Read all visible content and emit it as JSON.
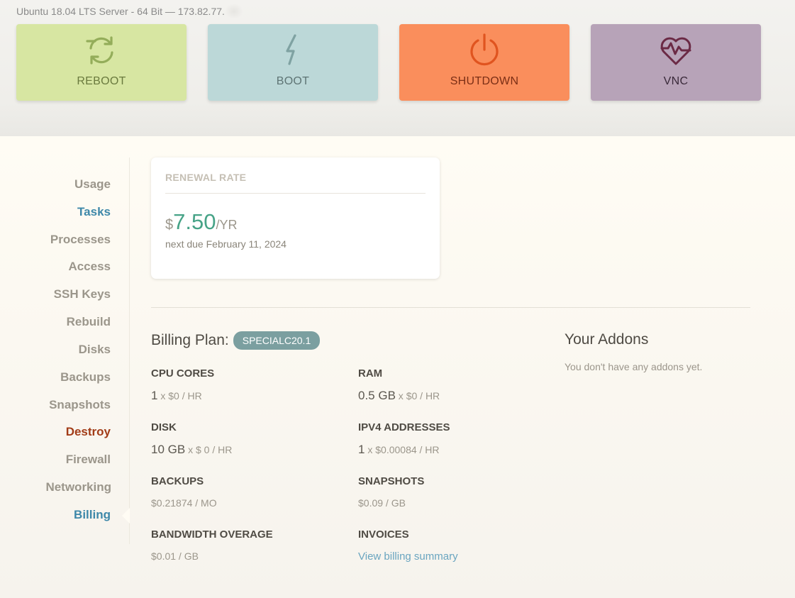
{
  "header": {
    "server_line": "Ubuntu 18.04 LTS Server - 64 Bit — 173.82.77."
  },
  "actions": [
    {
      "label": "REBOOT",
      "icon": "reboot-icon",
      "color": "#d7e6a2"
    },
    {
      "label": "BOOT",
      "icon": "lightning-icon",
      "color": "#bcd8d8"
    },
    {
      "label": "SHUTDOWN",
      "icon": "power-icon",
      "color": "#fa8e5c"
    },
    {
      "label": "VNC",
      "icon": "heart-monitor-icon",
      "color": "#b7a3b8"
    }
  ],
  "sidebar": {
    "items": [
      {
        "label": "Usage"
      },
      {
        "label": "Tasks"
      },
      {
        "label": "Processes"
      },
      {
        "label": "Access"
      },
      {
        "label": "SSH Keys"
      },
      {
        "label": "Rebuild"
      },
      {
        "label": "Disks"
      },
      {
        "label": "Backups"
      },
      {
        "label": "Snapshots"
      },
      {
        "label": "Destroy"
      },
      {
        "label": "Firewall"
      },
      {
        "label": "Networking"
      },
      {
        "label": "Billing"
      }
    ],
    "active": "Billing"
  },
  "renewal": {
    "title": "RENEWAL RATE",
    "currency": "$",
    "amount": "7.50",
    "period": "/YR",
    "due": "next due February 11, 2024"
  },
  "billing": {
    "plan_label": "Billing Plan:",
    "plan_name": "SPECIALC20.1",
    "specs": {
      "cpu": {
        "label": "CPU CORES",
        "value": "1",
        "rate": " x $0 / HR"
      },
      "ram": {
        "label": "RAM",
        "value": "0.5 GB",
        "rate": " x $0 / HR"
      },
      "disk": {
        "label": "DISK",
        "value": "10 GB",
        "rate": " x $ 0 / HR"
      },
      "ipv4": {
        "label": "IPV4 ADDRESSES",
        "value": "1",
        "rate": " x $0.00084 / HR"
      },
      "backups": {
        "label": "BACKUPS",
        "value": "$0.21874 / MO"
      },
      "snapshots": {
        "label": "SNAPSHOTS",
        "value": "$0.09 / GB"
      },
      "bandwidth": {
        "label": "BANDWIDTH OVERAGE",
        "value": "$0.01 / GB"
      },
      "invoices": {
        "label": "INVOICES",
        "link": "View billing summary"
      }
    }
  },
  "addons": {
    "title": "Your Addons",
    "empty": "You don't have any addons yet."
  },
  "colors": {
    "accent": "#3e88a9",
    "price": "#47a387",
    "danger": "#a23c18",
    "badge": "#7b9fa0"
  }
}
